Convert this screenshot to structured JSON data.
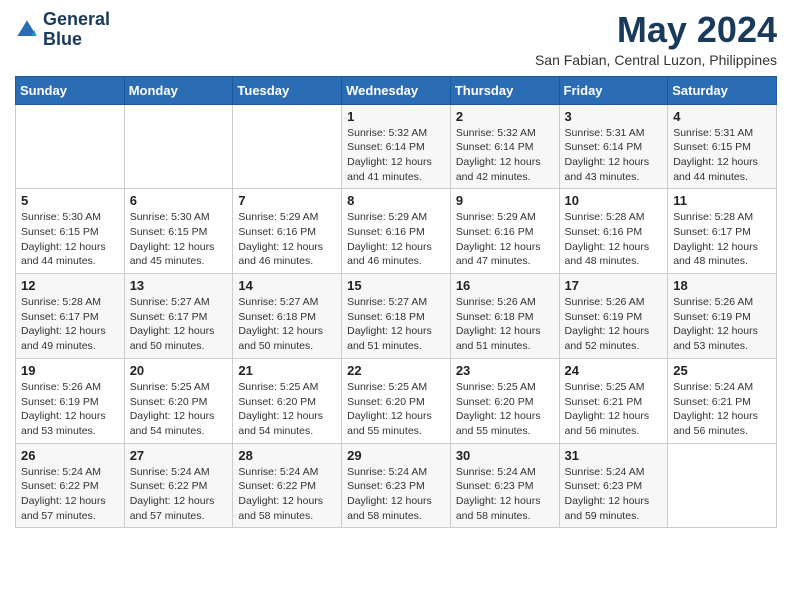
{
  "header": {
    "logo_line1": "General",
    "logo_line2": "Blue",
    "month_year": "May 2024",
    "location": "San Fabian, Central Luzon, Philippines"
  },
  "weekdays": [
    "Sunday",
    "Monday",
    "Tuesday",
    "Wednesday",
    "Thursday",
    "Friday",
    "Saturday"
  ],
  "weeks": [
    [
      {
        "day": "",
        "info": ""
      },
      {
        "day": "",
        "info": ""
      },
      {
        "day": "",
        "info": ""
      },
      {
        "day": "1",
        "info": "Sunrise: 5:32 AM\nSunset: 6:14 PM\nDaylight: 12 hours\nand 41 minutes."
      },
      {
        "day": "2",
        "info": "Sunrise: 5:32 AM\nSunset: 6:14 PM\nDaylight: 12 hours\nand 42 minutes."
      },
      {
        "day": "3",
        "info": "Sunrise: 5:31 AM\nSunset: 6:14 PM\nDaylight: 12 hours\nand 43 minutes."
      },
      {
        "day": "4",
        "info": "Sunrise: 5:31 AM\nSunset: 6:15 PM\nDaylight: 12 hours\nand 44 minutes."
      }
    ],
    [
      {
        "day": "5",
        "info": "Sunrise: 5:30 AM\nSunset: 6:15 PM\nDaylight: 12 hours\nand 44 minutes."
      },
      {
        "day": "6",
        "info": "Sunrise: 5:30 AM\nSunset: 6:15 PM\nDaylight: 12 hours\nand 45 minutes."
      },
      {
        "day": "7",
        "info": "Sunrise: 5:29 AM\nSunset: 6:16 PM\nDaylight: 12 hours\nand 46 minutes."
      },
      {
        "day": "8",
        "info": "Sunrise: 5:29 AM\nSunset: 6:16 PM\nDaylight: 12 hours\nand 46 minutes."
      },
      {
        "day": "9",
        "info": "Sunrise: 5:29 AM\nSunset: 6:16 PM\nDaylight: 12 hours\nand 47 minutes."
      },
      {
        "day": "10",
        "info": "Sunrise: 5:28 AM\nSunset: 6:16 PM\nDaylight: 12 hours\nand 48 minutes."
      },
      {
        "day": "11",
        "info": "Sunrise: 5:28 AM\nSunset: 6:17 PM\nDaylight: 12 hours\nand 48 minutes."
      }
    ],
    [
      {
        "day": "12",
        "info": "Sunrise: 5:28 AM\nSunset: 6:17 PM\nDaylight: 12 hours\nand 49 minutes."
      },
      {
        "day": "13",
        "info": "Sunrise: 5:27 AM\nSunset: 6:17 PM\nDaylight: 12 hours\nand 50 minutes."
      },
      {
        "day": "14",
        "info": "Sunrise: 5:27 AM\nSunset: 6:18 PM\nDaylight: 12 hours\nand 50 minutes."
      },
      {
        "day": "15",
        "info": "Sunrise: 5:27 AM\nSunset: 6:18 PM\nDaylight: 12 hours\nand 51 minutes."
      },
      {
        "day": "16",
        "info": "Sunrise: 5:26 AM\nSunset: 6:18 PM\nDaylight: 12 hours\nand 51 minutes."
      },
      {
        "day": "17",
        "info": "Sunrise: 5:26 AM\nSunset: 6:19 PM\nDaylight: 12 hours\nand 52 minutes."
      },
      {
        "day": "18",
        "info": "Sunrise: 5:26 AM\nSunset: 6:19 PM\nDaylight: 12 hours\nand 53 minutes."
      }
    ],
    [
      {
        "day": "19",
        "info": "Sunrise: 5:26 AM\nSunset: 6:19 PM\nDaylight: 12 hours\nand 53 minutes."
      },
      {
        "day": "20",
        "info": "Sunrise: 5:25 AM\nSunset: 6:20 PM\nDaylight: 12 hours\nand 54 minutes."
      },
      {
        "day": "21",
        "info": "Sunrise: 5:25 AM\nSunset: 6:20 PM\nDaylight: 12 hours\nand 54 minutes."
      },
      {
        "day": "22",
        "info": "Sunrise: 5:25 AM\nSunset: 6:20 PM\nDaylight: 12 hours\nand 55 minutes."
      },
      {
        "day": "23",
        "info": "Sunrise: 5:25 AM\nSunset: 6:20 PM\nDaylight: 12 hours\nand 55 minutes."
      },
      {
        "day": "24",
        "info": "Sunrise: 5:25 AM\nSunset: 6:21 PM\nDaylight: 12 hours\nand 56 minutes."
      },
      {
        "day": "25",
        "info": "Sunrise: 5:24 AM\nSunset: 6:21 PM\nDaylight: 12 hours\nand 56 minutes."
      }
    ],
    [
      {
        "day": "26",
        "info": "Sunrise: 5:24 AM\nSunset: 6:22 PM\nDaylight: 12 hours\nand 57 minutes."
      },
      {
        "day": "27",
        "info": "Sunrise: 5:24 AM\nSunset: 6:22 PM\nDaylight: 12 hours\nand 57 minutes."
      },
      {
        "day": "28",
        "info": "Sunrise: 5:24 AM\nSunset: 6:22 PM\nDaylight: 12 hours\nand 58 minutes."
      },
      {
        "day": "29",
        "info": "Sunrise: 5:24 AM\nSunset: 6:23 PM\nDaylight: 12 hours\nand 58 minutes."
      },
      {
        "day": "30",
        "info": "Sunrise: 5:24 AM\nSunset: 6:23 PM\nDaylight: 12 hours\nand 58 minutes."
      },
      {
        "day": "31",
        "info": "Sunrise: 5:24 AM\nSunset: 6:23 PM\nDaylight: 12 hours\nand 59 minutes."
      },
      {
        "day": "",
        "info": ""
      }
    ]
  ]
}
